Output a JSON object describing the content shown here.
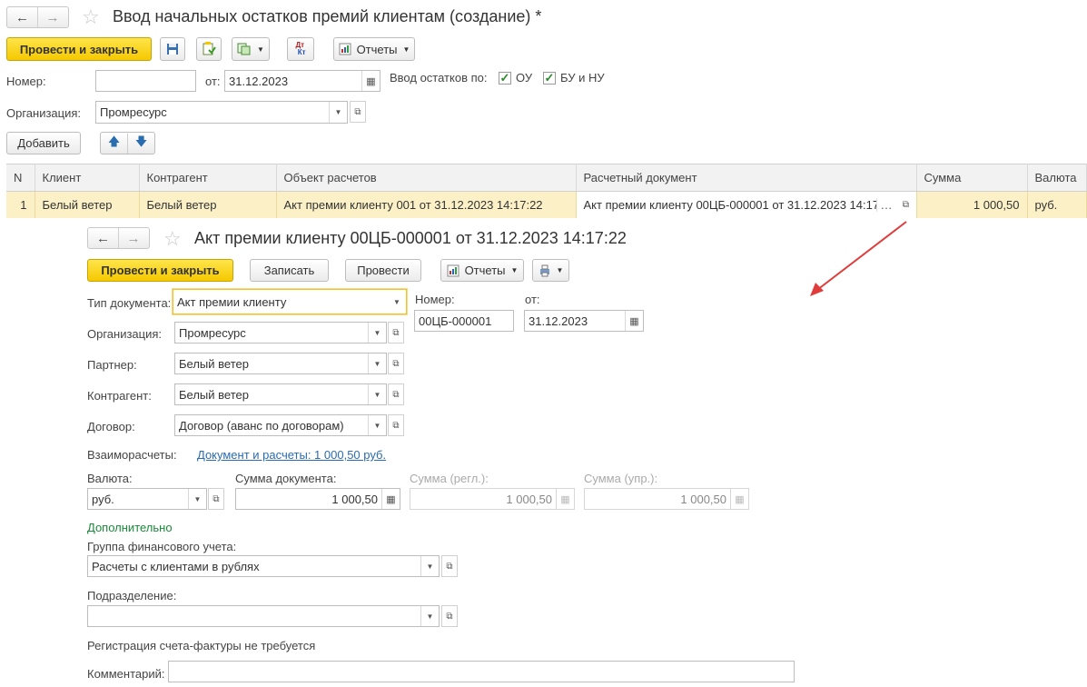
{
  "main": {
    "title": "Ввод начальных остатков премий клиентам (создание) *",
    "post_close": "Провести и закрыть",
    "reports": "Отчеты",
    "number_label": "Номер:",
    "number_value": "",
    "from_label": "от:",
    "date": "31.12.2023",
    "balances_label": "Ввод остатков по:",
    "check_ou": "ОУ",
    "check_bu": "БУ и НУ",
    "org_label": "Организация:",
    "org_value": "Промресурс",
    "add_btn": "Добавить",
    "table": {
      "columns": [
        "N",
        "Клиент",
        "Контрагент",
        "Объект расчетов",
        "Расчетный документ",
        "Сумма",
        "Валюта"
      ],
      "rows": [
        {
          "n": "1",
          "client": "Белый ветер",
          "counterparty": "Белый ветер",
          "object": "Акт премии клиенту 001 от 31.12.2023 14:17:22",
          "doc": "Акт премии клиенту 00ЦБ-000001 от 31.12.2023 14:17",
          "sum": "1 000,50",
          "currency": "руб."
        }
      ]
    }
  },
  "sub": {
    "title": "Акт премии клиенту 00ЦБ-000001 от 31.12.2023 14:17:22",
    "post_close": "Провести и закрыть",
    "write": "Записать",
    "post": "Провести",
    "reports": "Отчеты",
    "doc_type_label": "Тип документа:",
    "doc_type_value": "Акт премии клиенту",
    "number_label": "Номер:",
    "number_value": "00ЦБ-000001",
    "from_label": "от:",
    "date": "31.12.2023",
    "org_label": "Организация:",
    "org_value": "Промресурс",
    "partner_label": "Партнер:",
    "partner_value": "Белый ветер",
    "counterparty_label": "Контрагент:",
    "counterparty_value": "Белый ветер",
    "contract_label": "Договор:",
    "contract_value": "Договор (аванс по договорам)",
    "settlements_label": "Взаиморасчеты:",
    "settlements_link": "Документ и расчеты: 1 000,50 руб.",
    "currency_label": "Валюта:",
    "currency_value": "руб.",
    "doc_sum_label": "Сумма документа:",
    "doc_sum_value": "1 000,50",
    "sum_reg_label": "Сумма (регл.):",
    "sum_reg_value": "1 000,50",
    "sum_mgmt_label": "Сумма (упр.):",
    "sum_mgmt_value": "1 000,50",
    "additional": "Дополнительно",
    "fin_group_label": "Группа финансового учета:",
    "fin_group_value": "Расчеты с клиентами в рублях",
    "department_label": "Подразделение:",
    "department_value": "",
    "invoice_note": "Регистрация счета-фактуры не требуется",
    "comment_label": "Комментарий:",
    "comment_value": ""
  },
  "colors": {
    "accent_yellow": "#f5c800",
    "row_highlight": "#fbf0c6",
    "arrow_red": "#e03c3c",
    "link_blue": "#2a6cb0",
    "group_green": "#1a8a3a"
  }
}
